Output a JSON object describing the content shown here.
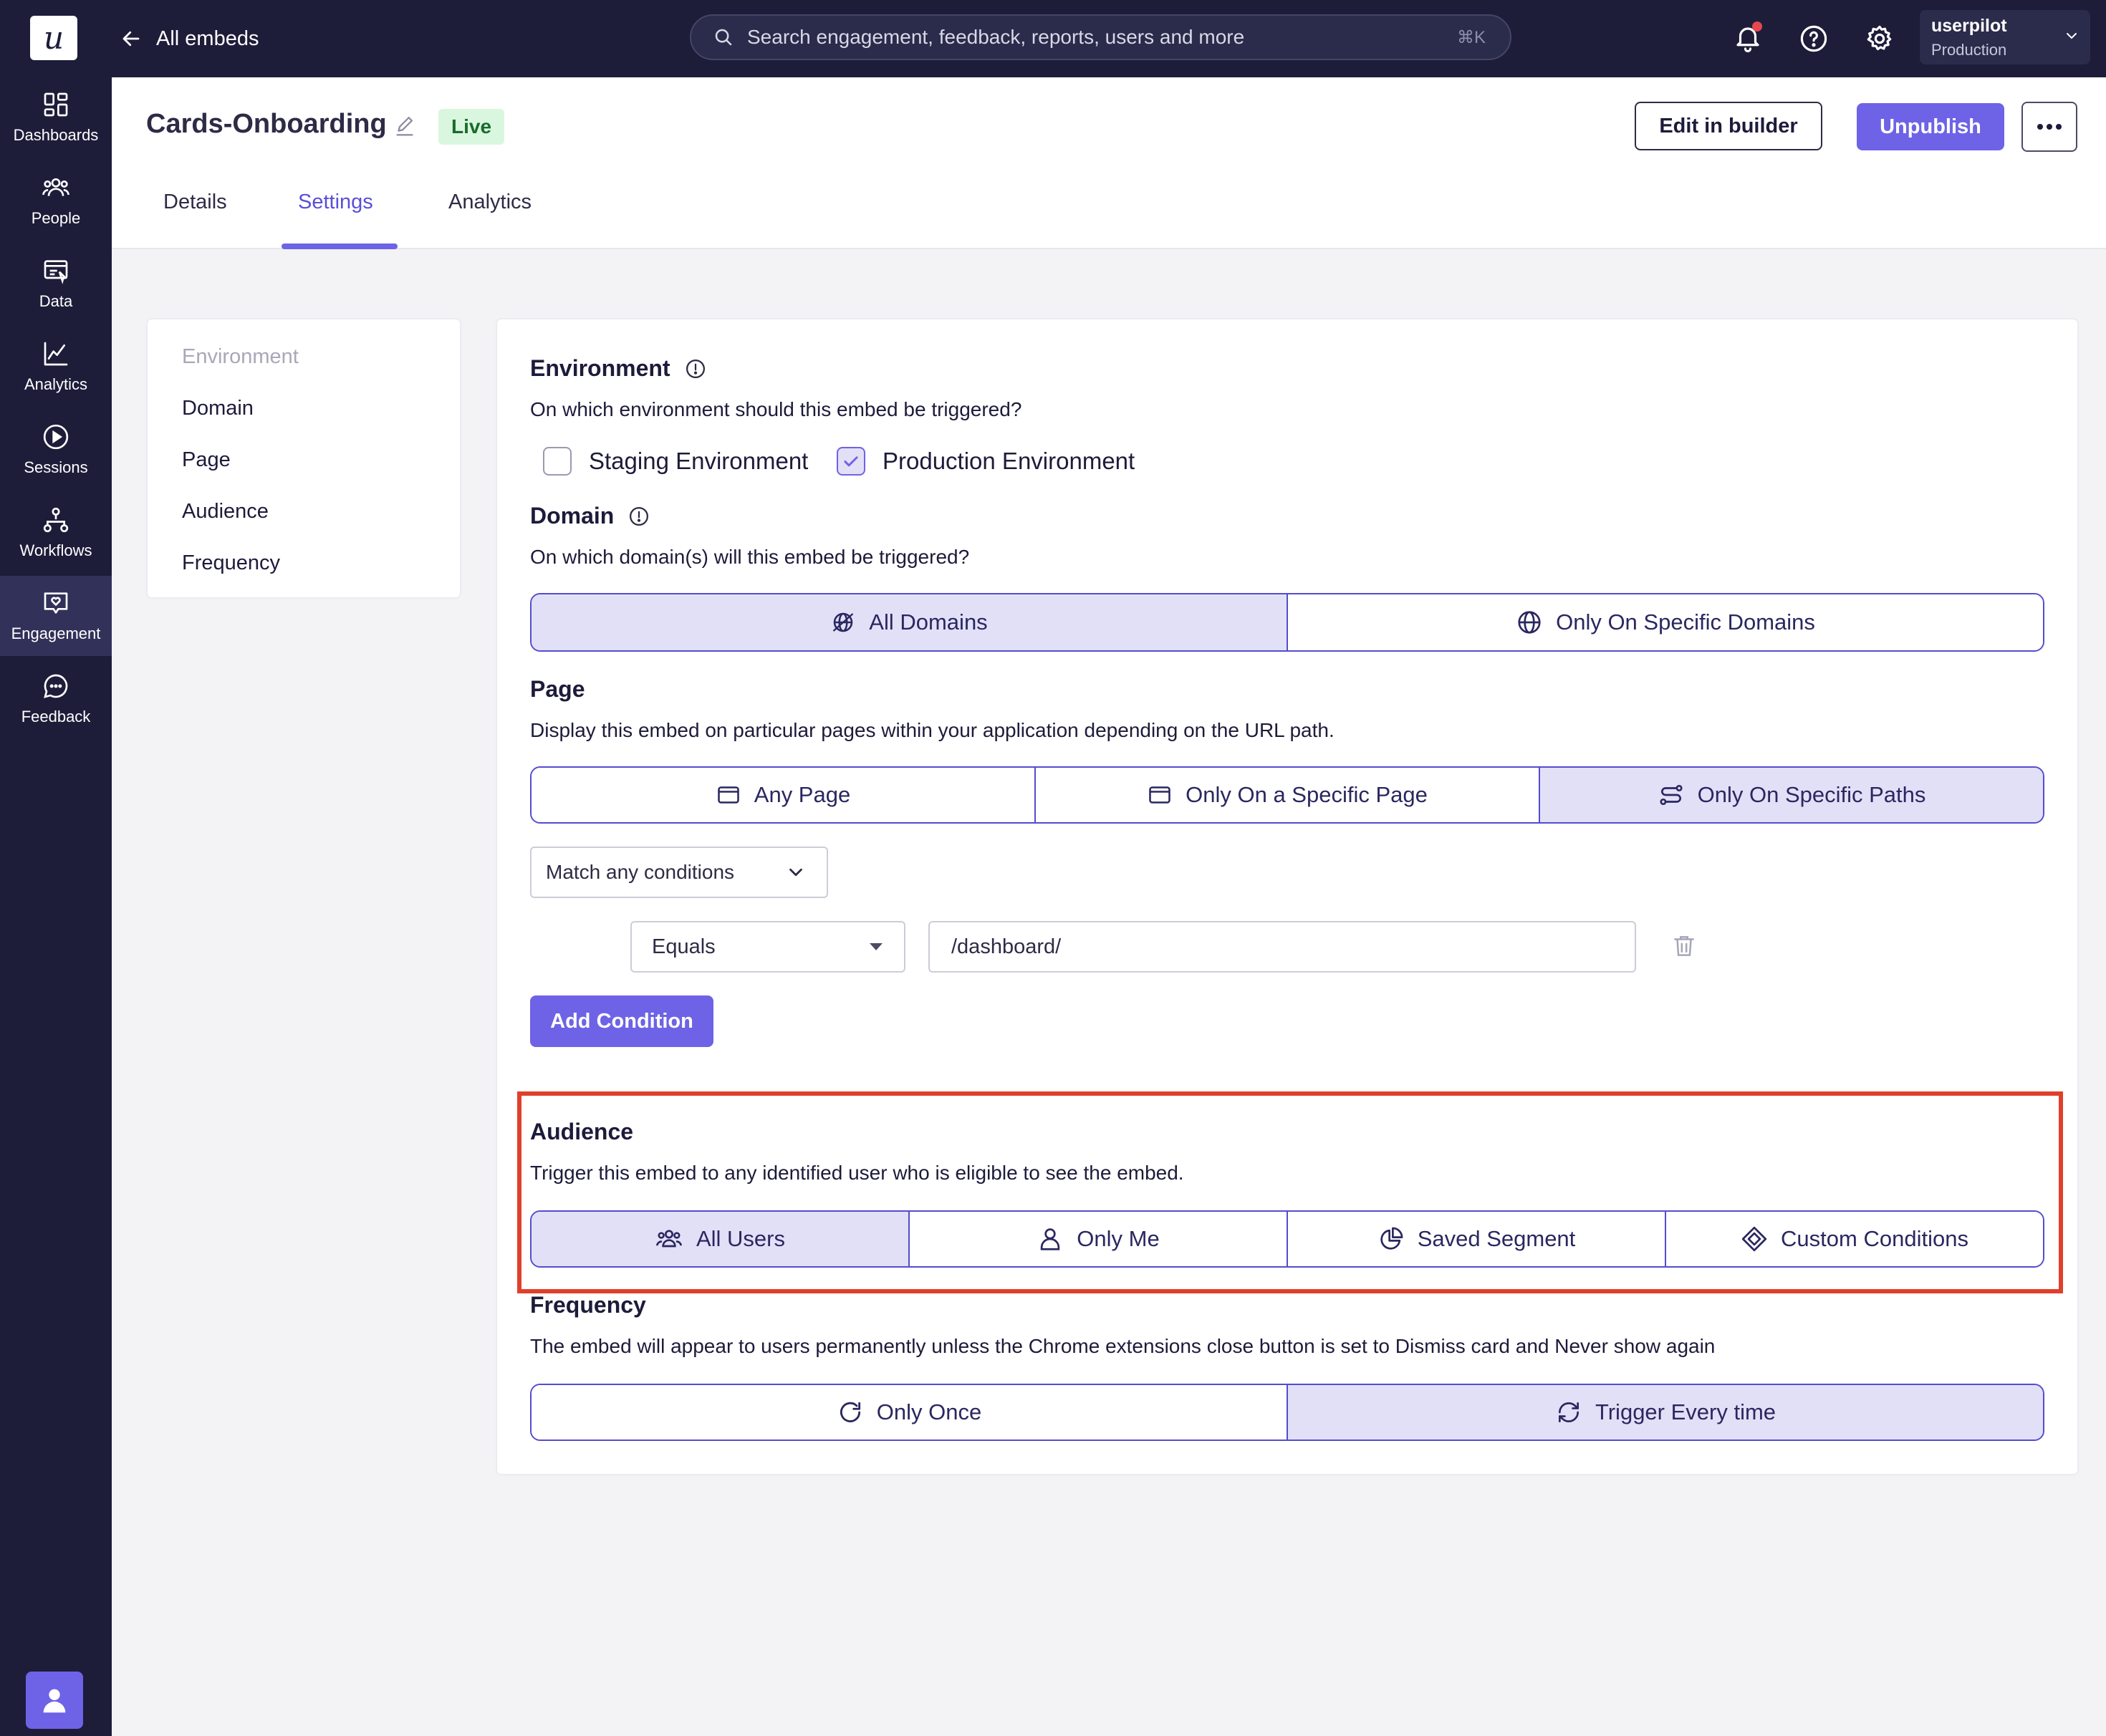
{
  "topbar": {
    "logo": "u",
    "back_label": "All embeds",
    "search_placeholder": "Search engagement, feedback, reports, users and more",
    "search_shortcut": "⌘K",
    "account_name": "userpilot",
    "account_env": "Production"
  },
  "sidebar": {
    "items": [
      {
        "label": "Dashboards",
        "icon": "dashboard-icon"
      },
      {
        "label": "People",
        "icon": "people-icon"
      },
      {
        "label": "Data",
        "icon": "data-icon"
      },
      {
        "label": "Analytics",
        "icon": "analytics-icon"
      },
      {
        "label": "Sessions",
        "icon": "play-icon"
      },
      {
        "label": "Workflows",
        "icon": "workflow-icon"
      },
      {
        "label": "Engagement",
        "icon": "engagement-icon"
      },
      {
        "label": "Feedback",
        "icon": "chat-icon"
      }
    ],
    "active": "Engagement"
  },
  "header": {
    "title": "Cards-Onboarding",
    "status": "Live",
    "edit_builder": "Edit in builder",
    "unpublish": "Unpublish",
    "tabs": [
      "Details",
      "Settings",
      "Analytics"
    ],
    "active_tab": "Settings"
  },
  "menu": {
    "items": [
      "Environment",
      "Domain",
      "Page",
      "Audience",
      "Frequency"
    ]
  },
  "environment": {
    "title": "Environment",
    "description": "On which environment should this embed be triggered?",
    "options": [
      {
        "label": "Staging Environment",
        "checked": false
      },
      {
        "label": "Production Environment",
        "checked": true
      }
    ]
  },
  "domain": {
    "title": "Domain",
    "description": "On which domain(s) will this embed be triggered?",
    "options": [
      "All Domains",
      "Only On Specific Domains"
    ],
    "selected": "All Domains"
  },
  "page": {
    "title": "Page",
    "description": "Display this embed on particular pages within your application depending on the URL path.",
    "options": [
      "Any Page",
      "Only On a Specific Page",
      "Only On Specific Paths"
    ],
    "selected": "Only On Specific Paths",
    "match_select": "Match any conditions",
    "operator": "Equals",
    "path_value": "/dashboard/",
    "add_condition": "Add Condition"
  },
  "audience": {
    "title": "Audience",
    "description": "Trigger this embed to any identified user who is eligible to see the embed.",
    "options": [
      "All Users",
      "Only Me",
      "Saved Segment",
      "Custom Conditions"
    ],
    "selected": "All Users"
  },
  "frequency": {
    "title": "Frequency",
    "description": "The embed will appear to users permanently unless the Chrome extensions close button is set to Dismiss card and Never show again",
    "options": [
      "Only Once",
      "Trigger Every time"
    ],
    "selected": "Trigger Every time"
  },
  "colors": {
    "nav_bg": "#1d1d3a",
    "accent": "#6e63e6",
    "selected_bg": "#e2e0f7",
    "highlight": "#e0402b"
  }
}
